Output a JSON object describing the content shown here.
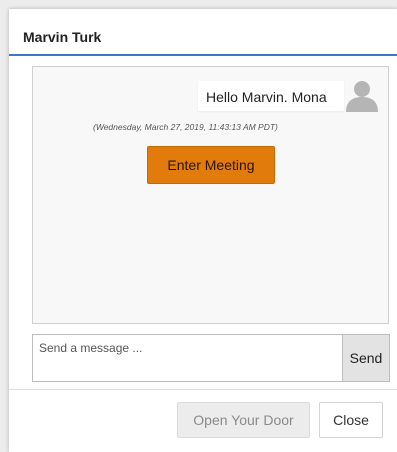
{
  "dialog": {
    "title": "Marvin Turk"
  },
  "chat": {
    "message_text": "Hello Marvin. Mona",
    "timestamp": "(Wednesday, March 27, 2019, 11:43:13 AM PDT)",
    "enter_meeting_label": "Enter Meeting",
    "avatar_icon": "user-silhouette-icon"
  },
  "composer": {
    "placeholder": "Send a message ...",
    "value": "",
    "send_label": "Send"
  },
  "footer": {
    "open_door_label": "Open Your Door",
    "close_label": "Close"
  },
  "colors": {
    "header_accent": "#3b78c3",
    "enter_meeting_bg": "#e07b0c",
    "avatar": "#b5b5b5"
  }
}
